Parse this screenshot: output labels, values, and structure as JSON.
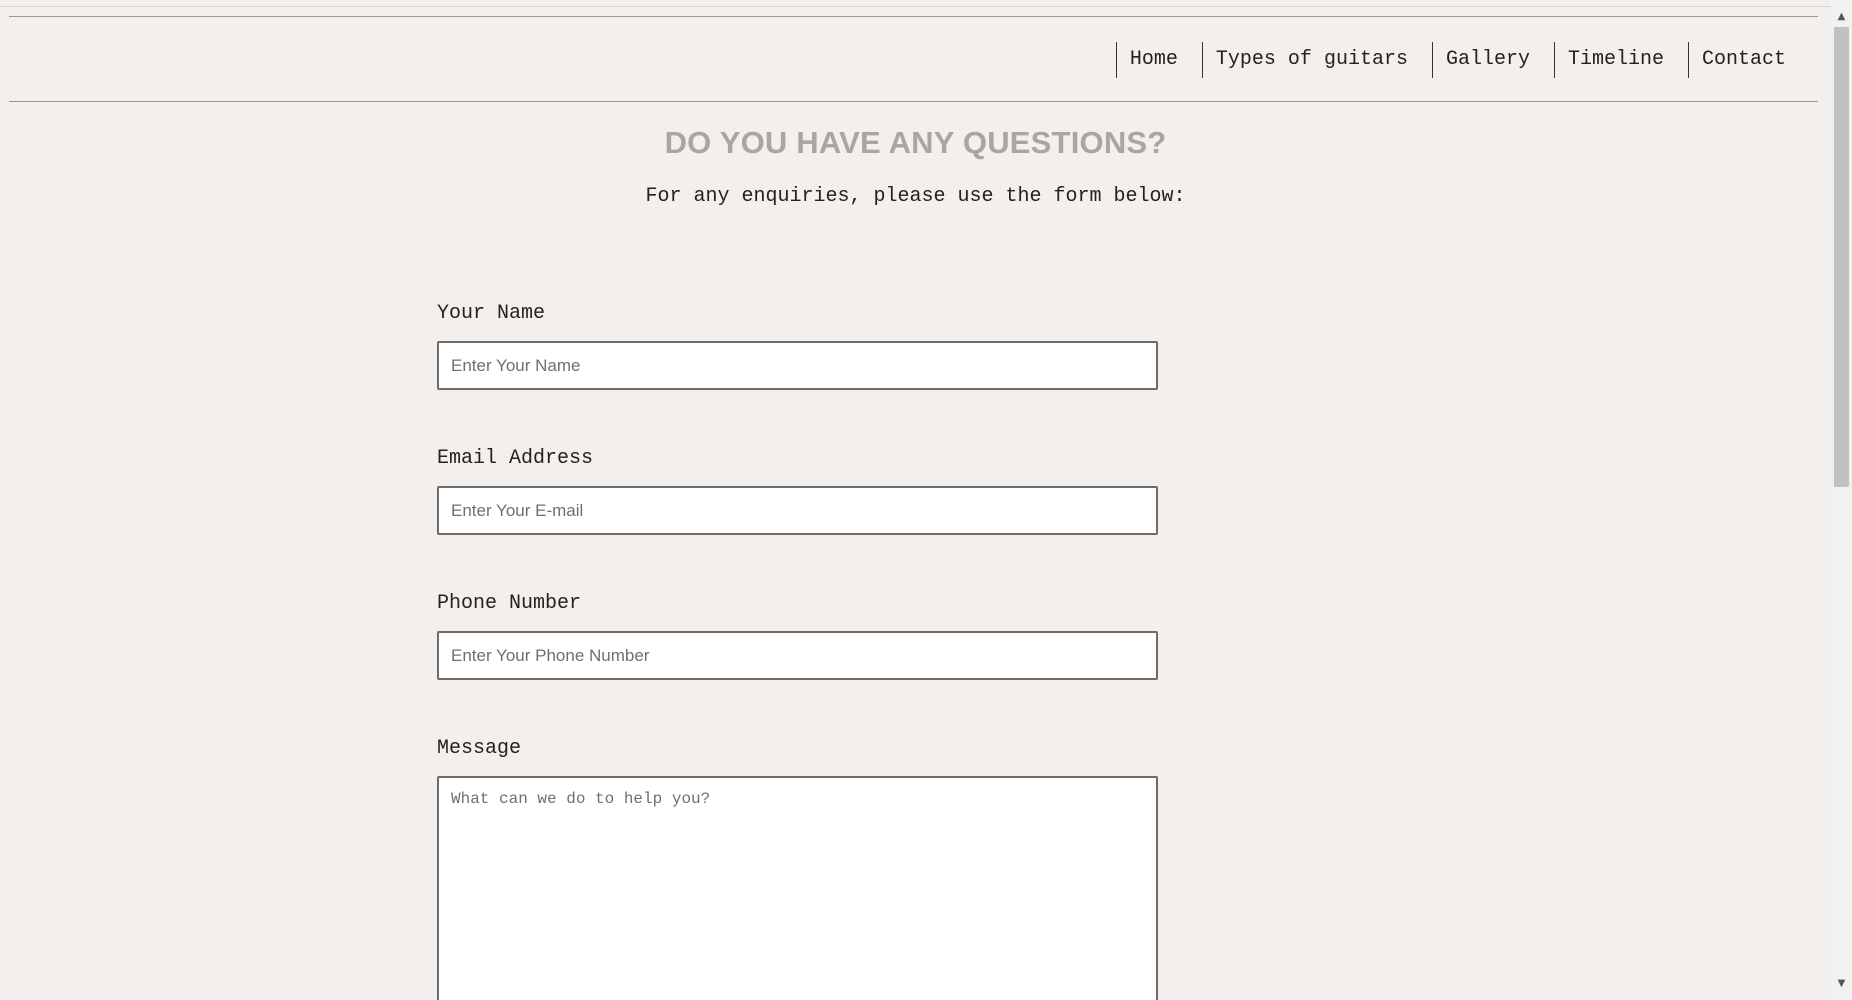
{
  "nav": {
    "items": [
      {
        "label": "Home"
      },
      {
        "label": "Types of guitars"
      },
      {
        "label": "Gallery"
      },
      {
        "label": "Timeline"
      },
      {
        "label": "Contact"
      }
    ]
  },
  "main": {
    "heading": "DO YOU HAVE ANY QUESTIONS?",
    "subheading": "For any enquiries, please use the form below:"
  },
  "form": {
    "name": {
      "label": "Your Name",
      "placeholder": "Enter Your Name",
      "value": ""
    },
    "email": {
      "label": "Email Address",
      "placeholder": "Enter Your E-mail",
      "value": ""
    },
    "phone": {
      "label": "Phone Number",
      "placeholder": "Enter Your Phone Number",
      "value": ""
    },
    "message": {
      "label": "Message",
      "placeholder": "What can we do to help you?",
      "value": ""
    }
  },
  "scrollbar": {
    "up_icon": "scroll-up-arrow-icon",
    "down_icon": "scroll-down-arrow-icon"
  },
  "colors": {
    "background": "#f3efec",
    "heading": "#a8a5a3",
    "input_border": "#6d6a68"
  }
}
